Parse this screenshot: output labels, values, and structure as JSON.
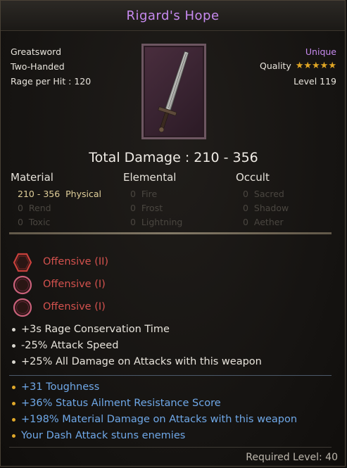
{
  "title": "Rigard's Hope",
  "item": {
    "type": "Greatsword",
    "handedness": "Two-Handed",
    "rage": "Rage per Hit : 120",
    "rarity": "Unique",
    "quality_label": "Quality",
    "quality_stars": 5,
    "level": "Level 119"
  },
  "total_damage": "Total Damage : 210 - 356",
  "damage_columns": [
    {
      "header": "Material",
      "rows": [
        {
          "value": "210 - 356",
          "label": "Physical",
          "active": true
        },
        {
          "value": "0",
          "label": "Rend",
          "active": false
        },
        {
          "value": "0",
          "label": "Toxic",
          "active": false
        }
      ]
    },
    {
      "header": "Elemental",
      "rows": [
        {
          "value": "0",
          "label": "Fire",
          "active": false
        },
        {
          "value": "0",
          "label": "Frost",
          "active": false
        },
        {
          "value": "0",
          "label": "Lightning",
          "active": false
        }
      ]
    },
    {
      "header": "Occult",
      "rows": [
        {
          "value": "0",
          "label": "Sacred",
          "active": false
        },
        {
          "value": "0",
          "label": "Shadow",
          "active": false
        },
        {
          "value": "0",
          "label": "Aether",
          "active": false
        }
      ]
    }
  ],
  "slots": [
    {
      "label": "Offensive (II)",
      "shape": "hexagon"
    },
    {
      "label": "Offensive (I)",
      "shape": "circle"
    },
    {
      "label": "Offensive (I)",
      "shape": "circle"
    }
  ],
  "stats": [
    "+3s Rage Conservation Time",
    "-25% Attack Speed",
    "+25% All Damage on Attacks with this weapon"
  ],
  "unique_stats": [
    "+31 Toughness",
    "+36% Status Ailment Resistance Score",
    "+198% Material Damage on Attacks with this weapon",
    "Your Dash Attack stuns enemies"
  ],
  "required_level": "Required Level: 40",
  "colors": {
    "title": "#c78af0",
    "slot": "#d4524e",
    "unique_stat": "#6fa8e8",
    "active_damage": "#e0cf9a",
    "star": "#e0a624"
  },
  "icons": {
    "weapon": "greatsword-icon",
    "star": "star-icon",
    "slot_hex": "hexagon-slot-icon",
    "slot_circle": "circle-slot-icon"
  }
}
